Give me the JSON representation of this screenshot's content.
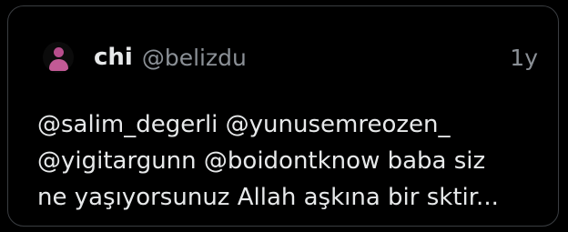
{
  "author": {
    "display_name": "chi",
    "handle": "@belizdu",
    "time": "1y",
    "avatar_icon": "default-person-avatar"
  },
  "tweet": {
    "lines": [
      "@salim_degerli @yunusemreozen_",
      "@yigitargunn @boidontknow baba siz",
      "ne yaşıyorsunuz Allah aşkına bir sktir..."
    ]
  },
  "colors": {
    "background": "#000000",
    "border": "#3a3d41",
    "text_primary": "#e7e9ea",
    "text_secondary": "#8b9096",
    "avatar_accent": "#c25a95"
  }
}
